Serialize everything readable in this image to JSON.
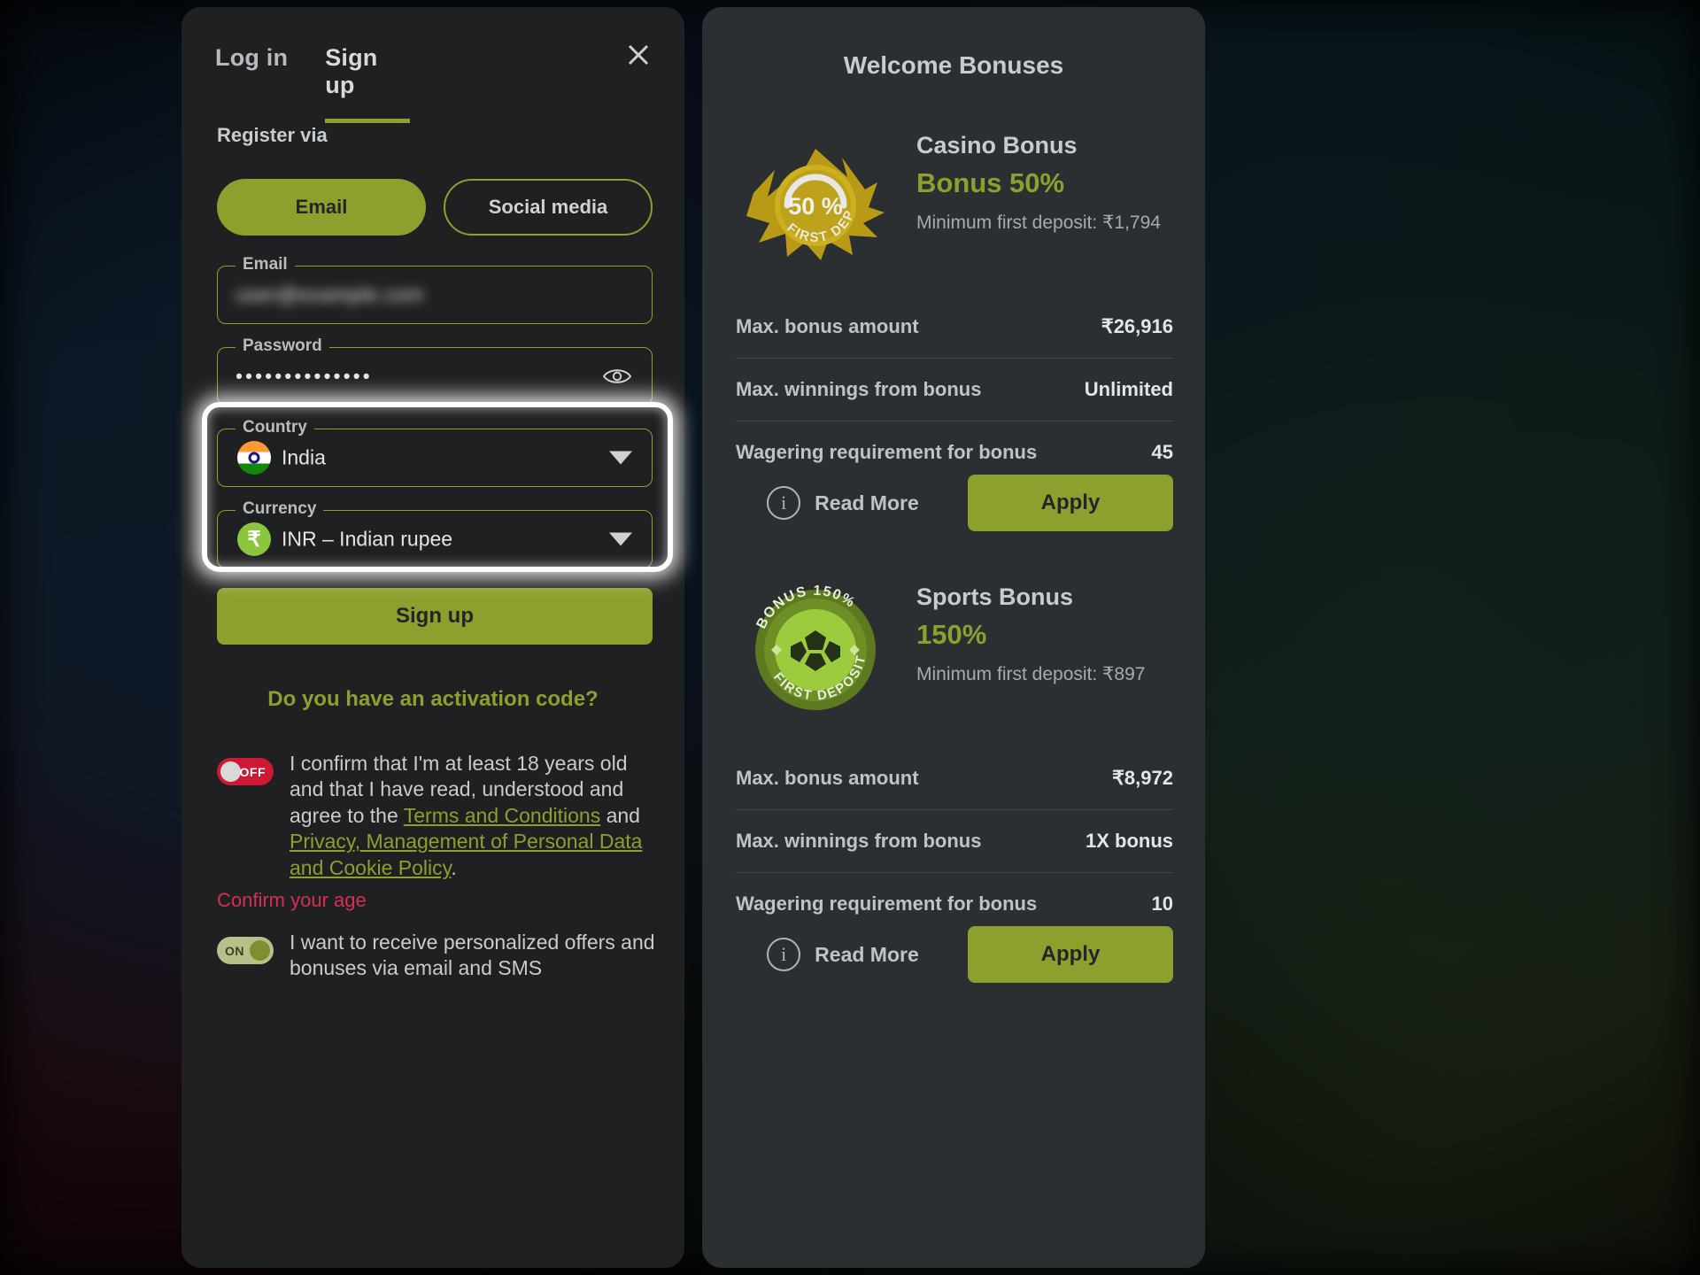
{
  "theme": {
    "accent": "#8ca02e",
    "panel_left_bg": "#1e2022",
    "panel_right_bg": "#2b2f31",
    "error_color": "#d6304f",
    "toggle_off_color": "#cf1836",
    "toggle_on_color": "#b7c08a"
  },
  "auth": {
    "tabs": [
      {
        "label": "Log in",
        "active": false
      },
      {
        "label": "Sign up",
        "active": true
      }
    ],
    "close_label": "Close",
    "register_via_label": "Register via",
    "methods": [
      {
        "label": "Email",
        "selected": true
      },
      {
        "label": "Social media",
        "selected": false
      }
    ],
    "fields": {
      "email": {
        "legend": "Email",
        "value": "",
        "redacted": true
      },
      "password": {
        "legend": "Password",
        "value": "••••••••••••••",
        "show_toggle_icon": "eye-icon"
      },
      "country": {
        "legend": "Country",
        "value": "India",
        "icon": "india-flag-icon",
        "caret": "chevron-down-icon"
      },
      "currency": {
        "legend": "Currency",
        "value": "INR – Indian rupee",
        "icon": "rupee-icon",
        "caret": "chevron-down-icon"
      }
    },
    "submit_label": "Sign up",
    "activation_code_label": "Do you have an activation code?",
    "consents": [
      {
        "toggle_state": "OFF",
        "text_before": "I confirm that I'm at least 18 years old and that I have read, understood and agree to the ",
        "link1": "Terms and Conditions",
        "text_mid": " and ",
        "link2": "Privacy, Management of Personal Data and Cookie Policy",
        "text_after": "."
      },
      {
        "toggle_state": "ON",
        "text": "I want to receive personalized offers and bonuses via email and SMS"
      }
    ],
    "error_message": "Confirm your age"
  },
  "bonuses": {
    "title": "Welcome Bonuses",
    "items": [
      {
        "badge_percent": "50 %",
        "badge_caption": "FIRST DEPOSIT",
        "badge_style": "gold",
        "name": "Casino Bonus",
        "headline": "Bonus 50%",
        "minimum_deposit": "Minimum first deposit: ₹1,794",
        "stats": [
          {
            "label": "Max. bonus amount",
            "value": "₹26,916"
          },
          {
            "label": "Max. winnings from bonus",
            "value": "Unlimited"
          },
          {
            "label": "Wagering requirement for bonus",
            "value": "45"
          }
        ],
        "read_more_label": "Read More",
        "apply_label": "Apply"
      },
      {
        "badge_percent": "BONUS 150%",
        "badge_caption": "FIRST DEPOSIT",
        "badge_style": "green",
        "name": "Sports Bonus",
        "headline": "150%",
        "minimum_deposit": "Minimum first deposit: ₹897",
        "stats": [
          {
            "label": "Max. bonus amount",
            "value": "₹8,972"
          },
          {
            "label": "Max. winnings from bonus",
            "value": "1X bonus"
          },
          {
            "label": "Wagering requirement for bonus",
            "value": "10"
          }
        ],
        "read_more_label": "Read More",
        "apply_label": "Apply"
      }
    ]
  }
}
